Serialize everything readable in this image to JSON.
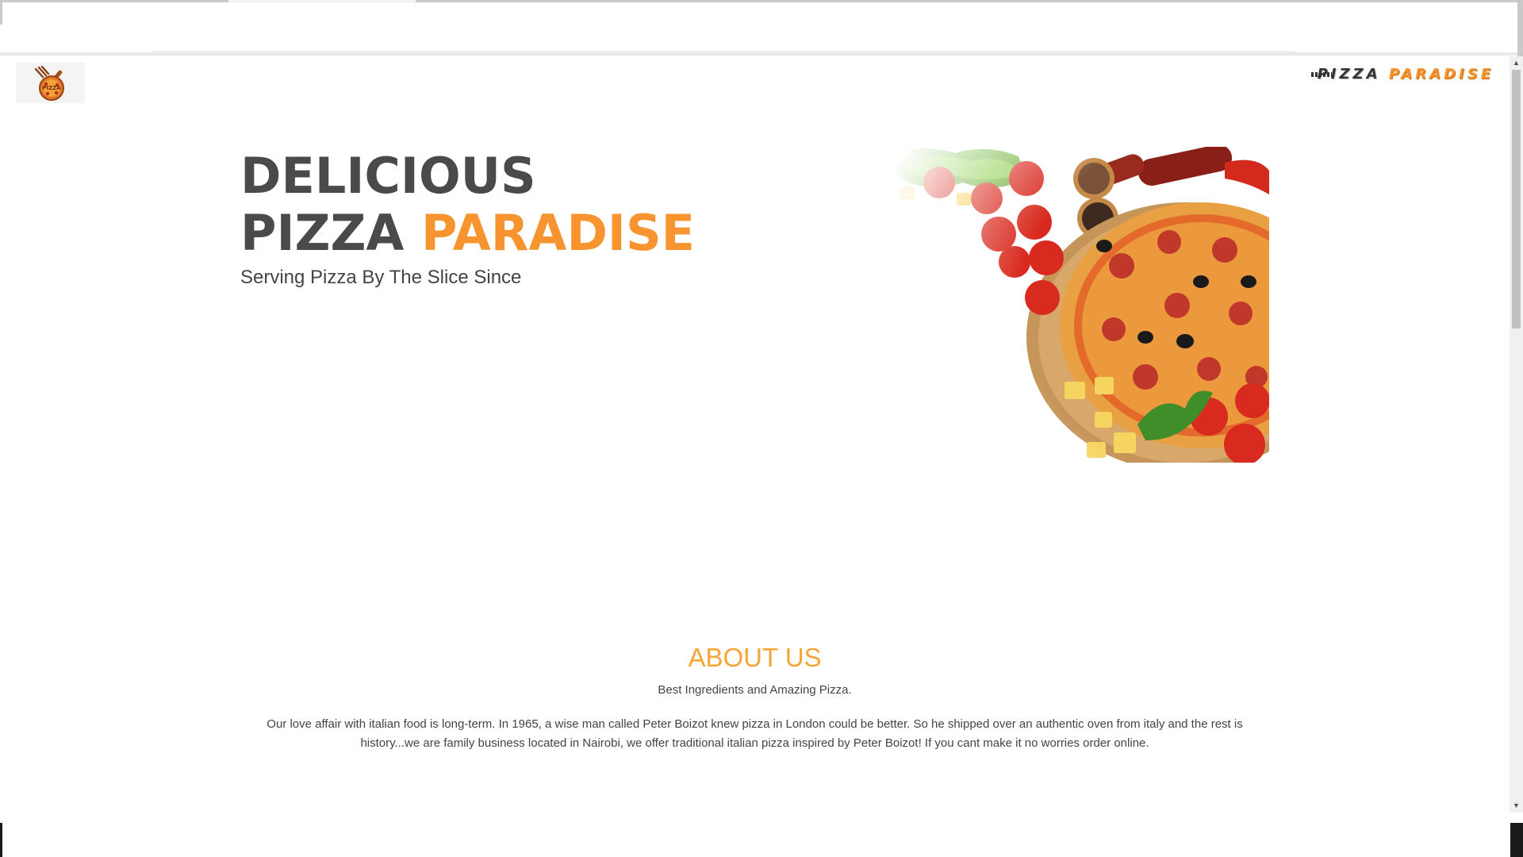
{
  "header": {
    "logo_text": "PIZZA",
    "brand_word1": "PIZZA",
    "brand_word2": "PARADISE"
  },
  "hero": {
    "title_line1": "DELICIOUS",
    "title_line2_part1": "PIZZA",
    "title_line2_part2": "PARADISE",
    "subtitle": "Serving Pizza By The Slice Since"
  },
  "about": {
    "title": "ABOUT US",
    "tagline": "Best Ingredients and Amazing Pizza.",
    "body": "Our love affair with italian food is long-term. In 1965, a wise man called Peter Boizot knew pizza in London could be better. So he shipped over an authentic oven from italy and the rest is history...we are family business located in Nairobi, we offer traditional italian pizza inspired by Peter Boizot! If you cant make it no worries order online."
  },
  "colors": {
    "accent": "#f7942f",
    "about_title": "#f7a534",
    "heading_dark": "#4a4a4a",
    "body_text": "#444444"
  },
  "icons": {
    "logo": "pizza-logo-icon",
    "scroll_up": "scroll-up-arrow-icon",
    "scroll_down": "scroll-down-arrow-icon"
  }
}
